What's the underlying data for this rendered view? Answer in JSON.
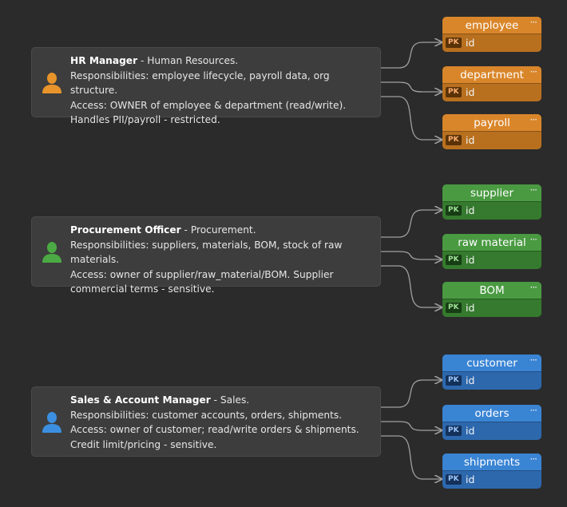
{
  "roles": [
    {
      "title": "HR Manager",
      "dept": " - Human Resources.",
      "responsibilities": "Responsibilities: employee lifecycle, payroll data, org structure.",
      "access": "Access: OWNER of employee & department (read/write). Handles PII/payroll - restricted.",
      "color": "#e8942a",
      "icon": "user-icon"
    },
    {
      "title": "Procurement Officer",
      "dept": " - Procurement.",
      "responsibilities": "Responsibilities: suppliers, materials, BOM, stock of raw materials.",
      "access": "Access: owner of supplier/raw_material/BOM. Supplier commercial terms - sensitive.",
      "color": "#4caa44",
      "icon": "user-icon"
    },
    {
      "title": "Sales & Account Manager",
      "dept": " - Sales.",
      "responsibilities": "Responsibilities: customer accounts, orders, shipments.",
      "access": "Access: owner of customer; read/write orders & shipments. Credit limit/pricing - sensitive.",
      "color": "#3c8fe0",
      "icon": "user-icon"
    }
  ],
  "tables": [
    {
      "name": "employee",
      "pk_label": "PK",
      "column": "id",
      "group": 0
    },
    {
      "name": "department",
      "pk_label": "PK",
      "column": "id",
      "group": 0
    },
    {
      "name": "payroll",
      "pk_label": "PK",
      "column": "id",
      "group": 0
    },
    {
      "name": "supplier",
      "pk_label": "PK",
      "column": "id",
      "group": 1
    },
    {
      "name": "raw material",
      "pk_label": "PK",
      "column": "id",
      "group": 1
    },
    {
      "name": "BOM",
      "pk_label": "PK",
      "column": "id",
      "group": 1
    },
    {
      "name": "customer",
      "pk_label": "PK",
      "column": "id",
      "group": 2
    },
    {
      "name": "orders",
      "pk_label": "PK",
      "column": "id",
      "group": 2
    },
    {
      "name": "shipments",
      "pk_label": "PK",
      "column": "id",
      "group": 2
    }
  ],
  "theme": {
    "background": "#2b2b2b",
    "card": "#3d3d3d",
    "link": "#a0a0a0",
    "groups": [
      {
        "header": "#d9862a",
        "body": "#b8701f",
        "pk_bg": "#5a3208",
        "pk_fg": "#ffb070"
      },
      {
        "header": "#4a9a42",
        "body": "#357a2e",
        "pk_bg": "#173d14",
        "pk_fg": "#9fe296"
      },
      {
        "header": "#3a84d4",
        "body": "#2d68ad",
        "pk_bg": "#14315a",
        "pk_fg": "#9cc8ff"
      }
    ]
  },
  "menu_glyph": "···"
}
